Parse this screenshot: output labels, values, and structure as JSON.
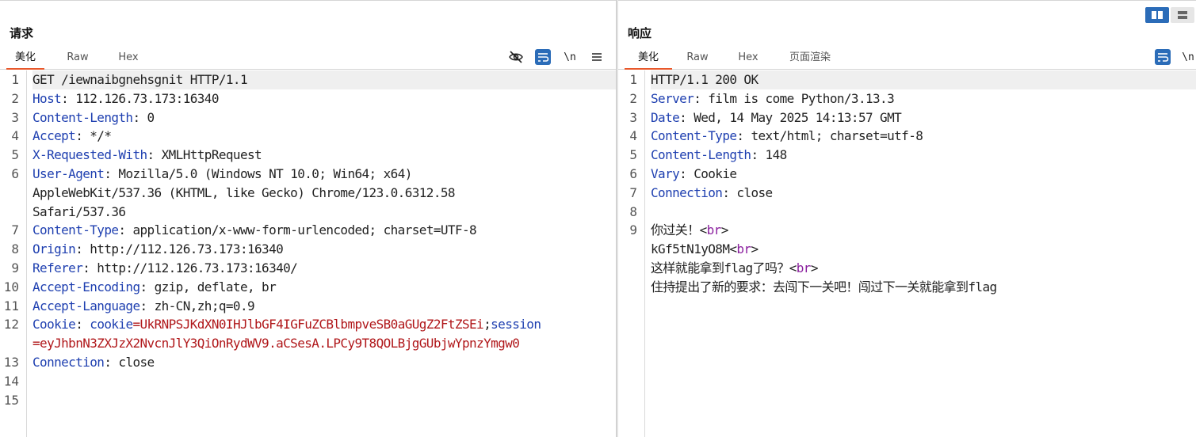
{
  "request": {
    "title": "请求",
    "tabs": [
      "美化",
      "Raw",
      "Hex"
    ],
    "tool_newline": "\\n",
    "lines": [
      {
        "n": "1",
        "parts": [
          {
            "t": "GET /iewnaibgnehsgnit HTTP/1.1",
            "c": "v"
          }
        ],
        "hl": true
      },
      {
        "n": "2",
        "parts": [
          {
            "t": "Host",
            "c": "k"
          },
          {
            "t": ": 112.126.73.173:16340",
            "c": "v"
          }
        ]
      },
      {
        "n": "3",
        "parts": [
          {
            "t": "Content-Length",
            "c": "k"
          },
          {
            "t": ": 0",
            "c": "v"
          }
        ]
      },
      {
        "n": "4",
        "parts": [
          {
            "t": "Accept",
            "c": "k"
          },
          {
            "t": ": */*",
            "c": "v"
          }
        ]
      },
      {
        "n": "5",
        "parts": [
          {
            "t": "X-Requested-With",
            "c": "k"
          },
          {
            "t": ": XMLHttpRequest",
            "c": "v"
          }
        ]
      },
      {
        "n": "6",
        "parts": [
          {
            "t": "User-Agent",
            "c": "k"
          },
          {
            "t": ": Mozilla/5.0 (Windows NT 10.0; Win64; x64)",
            "c": "v"
          }
        ]
      },
      {
        "n": "",
        "parts": [
          {
            "t": "AppleWebKit/537.36 (KHTML, like Gecko) Chrome/123.0.6312.58",
            "c": "v"
          }
        ]
      },
      {
        "n": "",
        "parts": [
          {
            "t": "Safari/537.36",
            "c": "v"
          }
        ]
      },
      {
        "n": "7",
        "parts": [
          {
            "t": "Content-Type",
            "c": "k"
          },
          {
            "t": ": application/x-www-form-urlencoded; charset=UTF-8",
            "c": "v"
          }
        ]
      },
      {
        "n": "8",
        "parts": [
          {
            "t": "Origin",
            "c": "k"
          },
          {
            "t": ": http://112.126.73.173:16340",
            "c": "v"
          }
        ]
      },
      {
        "n": "9",
        "parts": [
          {
            "t": "Referer",
            "c": "k"
          },
          {
            "t": ": http://112.126.73.173:16340/",
            "c": "v"
          }
        ]
      },
      {
        "n": "10",
        "parts": [
          {
            "t": "Accept-Encoding",
            "c": "k"
          },
          {
            "t": ": gzip, deflate, br",
            "c": "v"
          }
        ]
      },
      {
        "n": "11",
        "parts": [
          {
            "t": "Accept-Language",
            "c": "k"
          },
          {
            "t": ": zh-CN,zh;q=0.9",
            "c": "v"
          }
        ]
      },
      {
        "n": "12",
        "parts": [
          {
            "t": "Cookie",
            "c": "k"
          },
          {
            "t": ": ",
            "c": "v"
          },
          {
            "t": "cookie",
            "c": "ck"
          },
          {
            "t": "=UkRNPSJKdXN0IHJlbGF4IGFuZCBlbmpveSB0aGUgZ2FtZSEi",
            "c": "cv"
          },
          {
            "t": ";",
            "c": "v"
          },
          {
            "t": "session",
            "c": "ck"
          }
        ]
      },
      {
        "n": "",
        "parts": [
          {
            "t": "=eyJhbnN3ZXJzX2NvcnJlY3QiOnRydWV9.aCSesA.LPCy9T8QOLBjgGUbjwYpnzYmgw0",
            "c": "cv"
          }
        ]
      },
      {
        "n": "13",
        "parts": [
          {
            "t": "Connection",
            "c": "k"
          },
          {
            "t": ": close",
            "c": "v"
          }
        ]
      },
      {
        "n": "14",
        "parts": []
      },
      {
        "n": "15",
        "parts": []
      }
    ]
  },
  "response": {
    "title": "响应",
    "tabs": [
      "美化",
      "Raw",
      "Hex",
      "页面渲染"
    ],
    "tool_newline": "\\n",
    "lines": [
      {
        "n": "1",
        "parts": [
          {
            "t": "HTTP/1.1 200 OK",
            "c": "v"
          }
        ],
        "hl": true
      },
      {
        "n": "2",
        "parts": [
          {
            "t": "Server",
            "c": "k"
          },
          {
            "t": ": film is come Python/3.13.3",
            "c": "v"
          }
        ]
      },
      {
        "n": "3",
        "parts": [
          {
            "t": "Date",
            "c": "k"
          },
          {
            "t": ": Wed, 14 May 2025 14:13:57 GMT",
            "c": "v"
          }
        ]
      },
      {
        "n": "4",
        "parts": [
          {
            "t": "Content-Type",
            "c": "k"
          },
          {
            "t": ": text/html; charset=utf-8",
            "c": "v"
          }
        ]
      },
      {
        "n": "5",
        "parts": [
          {
            "t": "Content-Length",
            "c": "k"
          },
          {
            "t": ": 148",
            "c": "v"
          }
        ]
      },
      {
        "n": "6",
        "parts": [
          {
            "t": "Vary",
            "c": "k"
          },
          {
            "t": ": Cookie",
            "c": "v"
          }
        ]
      },
      {
        "n": "7",
        "parts": [
          {
            "t": "Connection",
            "c": "k"
          },
          {
            "t": ": close",
            "c": "v"
          }
        ]
      },
      {
        "n": "8",
        "parts": []
      },
      {
        "n": "9",
        "parts": [
          {
            "t": "你过关！<",
            "c": "v"
          },
          {
            "t": "br",
            "c": "tag"
          },
          {
            "t": ">",
            "c": "v"
          }
        ]
      },
      {
        "n": "",
        "parts": [
          {
            "t": "kGf5tN1yO8M<",
            "c": "v"
          },
          {
            "t": "br",
            "c": "tag"
          },
          {
            "t": ">",
            "c": "v"
          }
        ]
      },
      {
        "n": "",
        "parts": [
          {
            "t": "这样就能拿到flag了吗？<",
            "c": "v"
          },
          {
            "t": "br",
            "c": "tag"
          },
          {
            "t": ">",
            "c": "v"
          }
        ]
      },
      {
        "n": "",
        "parts": [
          {
            "t": "住持提出了新的要求：去闯下一关吧！闯过下一关就能拿到flag",
            "c": "v"
          }
        ]
      }
    ]
  },
  "colors": {
    "accent_tab_underline": "#e8582b",
    "header_key": "#1e3fb0",
    "cookie_value": "#b0171a",
    "html_tag": "#8a1e9e",
    "tool_blue": "#2b6cb8"
  }
}
